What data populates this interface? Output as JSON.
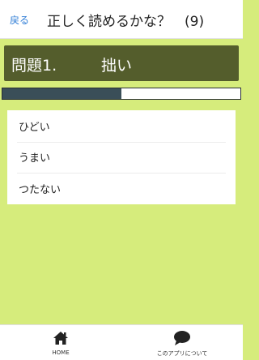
{
  "navbar": {
    "back_label": "戻る",
    "title": "正しく読めるかな？　(9)"
  },
  "question": {
    "number_label": "問題1.",
    "kanji": "拙い"
  },
  "progress": {
    "fraction": 0.5
  },
  "choices": [
    {
      "label": "ひどい"
    },
    {
      "label": "うまい"
    },
    {
      "label": "つたない"
    }
  ],
  "tabbar": {
    "tabs": [
      {
        "label": "HOME",
        "icon": "home-icon"
      },
      {
        "label": "このアプリについて",
        "icon": "chat-bubble-icon"
      }
    ]
  },
  "colors": {
    "background": "#d6ec7c",
    "banner": "#545d2c",
    "progress_fill": "#3a4e58",
    "link": "#2f7dd6"
  }
}
